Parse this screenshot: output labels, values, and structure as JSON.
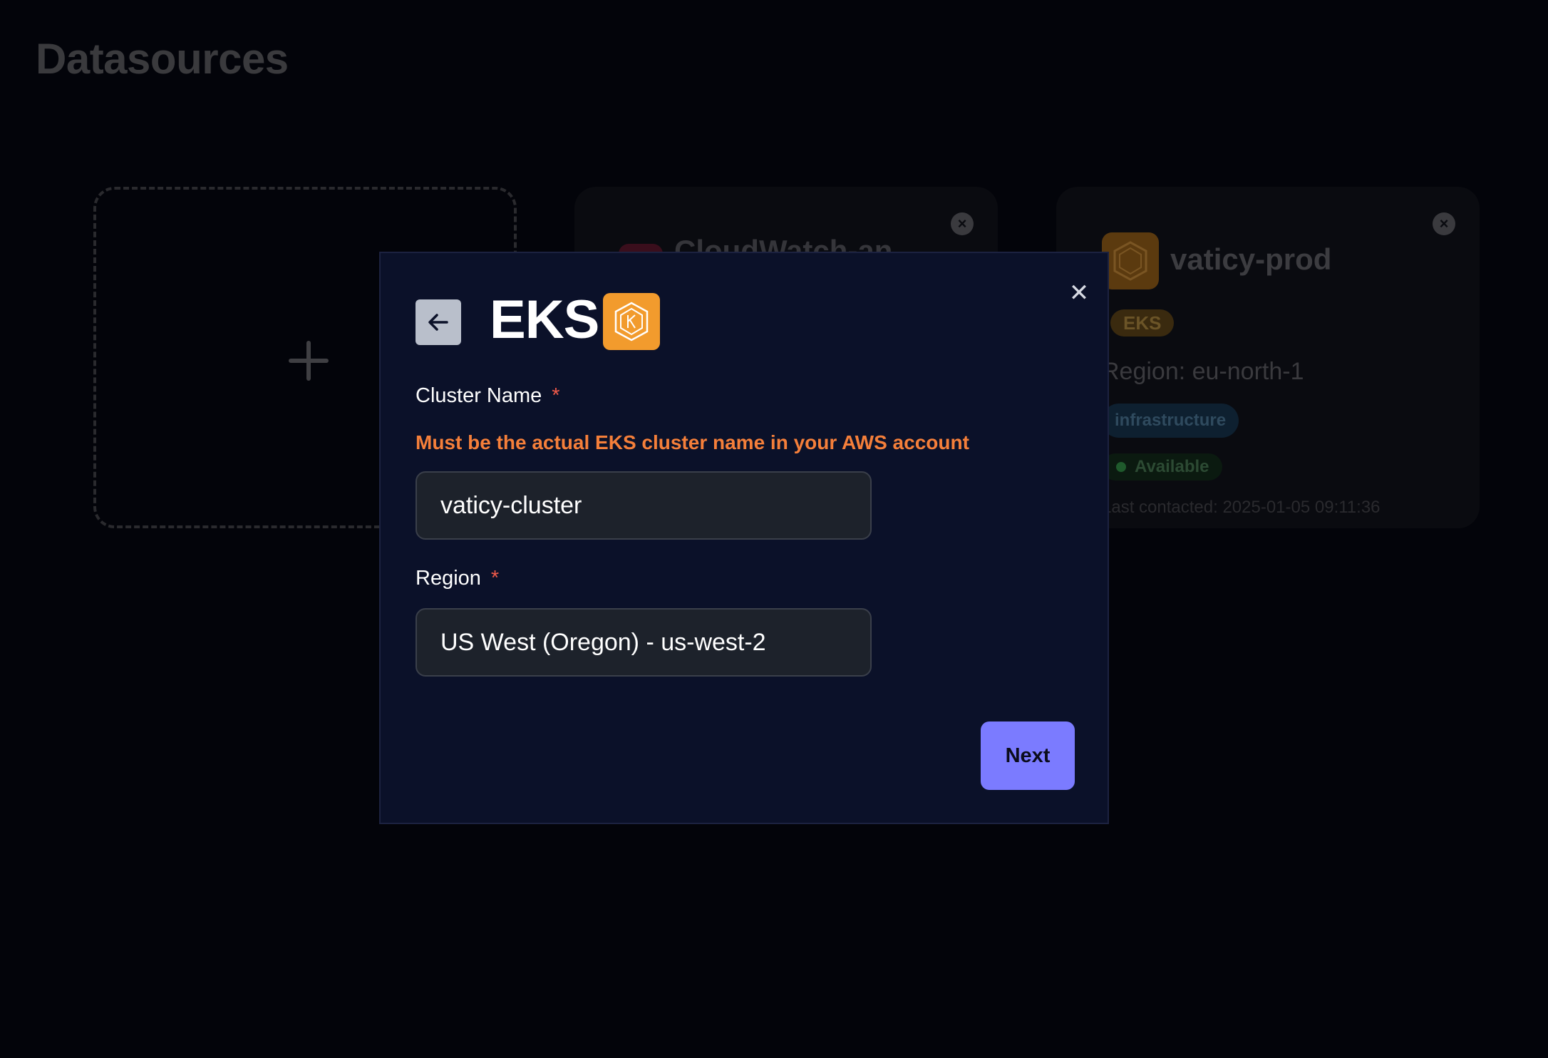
{
  "page": {
    "title": "Datasources"
  },
  "cards": {
    "cloudwatch": {
      "name": "CloudWatch-an"
    },
    "eks": {
      "name": "vaticy-prod",
      "type_badge": "EKS",
      "region": "Region: eu-north-1",
      "tag": "infrastructure",
      "status": "Available",
      "last_contacted": "Last contacted: 2025-01-05 09:11:36"
    }
  },
  "modal": {
    "title": "EKS",
    "close_icon": "close-icon",
    "back_icon": "arrow-left-icon",
    "cluster_name": {
      "label": "Cluster Name",
      "required_mark": "*",
      "hint": "Must be the actual EKS cluster name in your AWS account",
      "value": "vaticy-cluster"
    },
    "region": {
      "label": "Region",
      "required_mark": "*",
      "value": "US West (Oregon) - us-west-2"
    },
    "next_label": "Next"
  },
  "colors": {
    "modal_bg": "#0b1129",
    "accent": "#7b7bff",
    "hint": "#f57f3a",
    "required": "#f05a4a",
    "eks_orange": "#f29b2d"
  }
}
